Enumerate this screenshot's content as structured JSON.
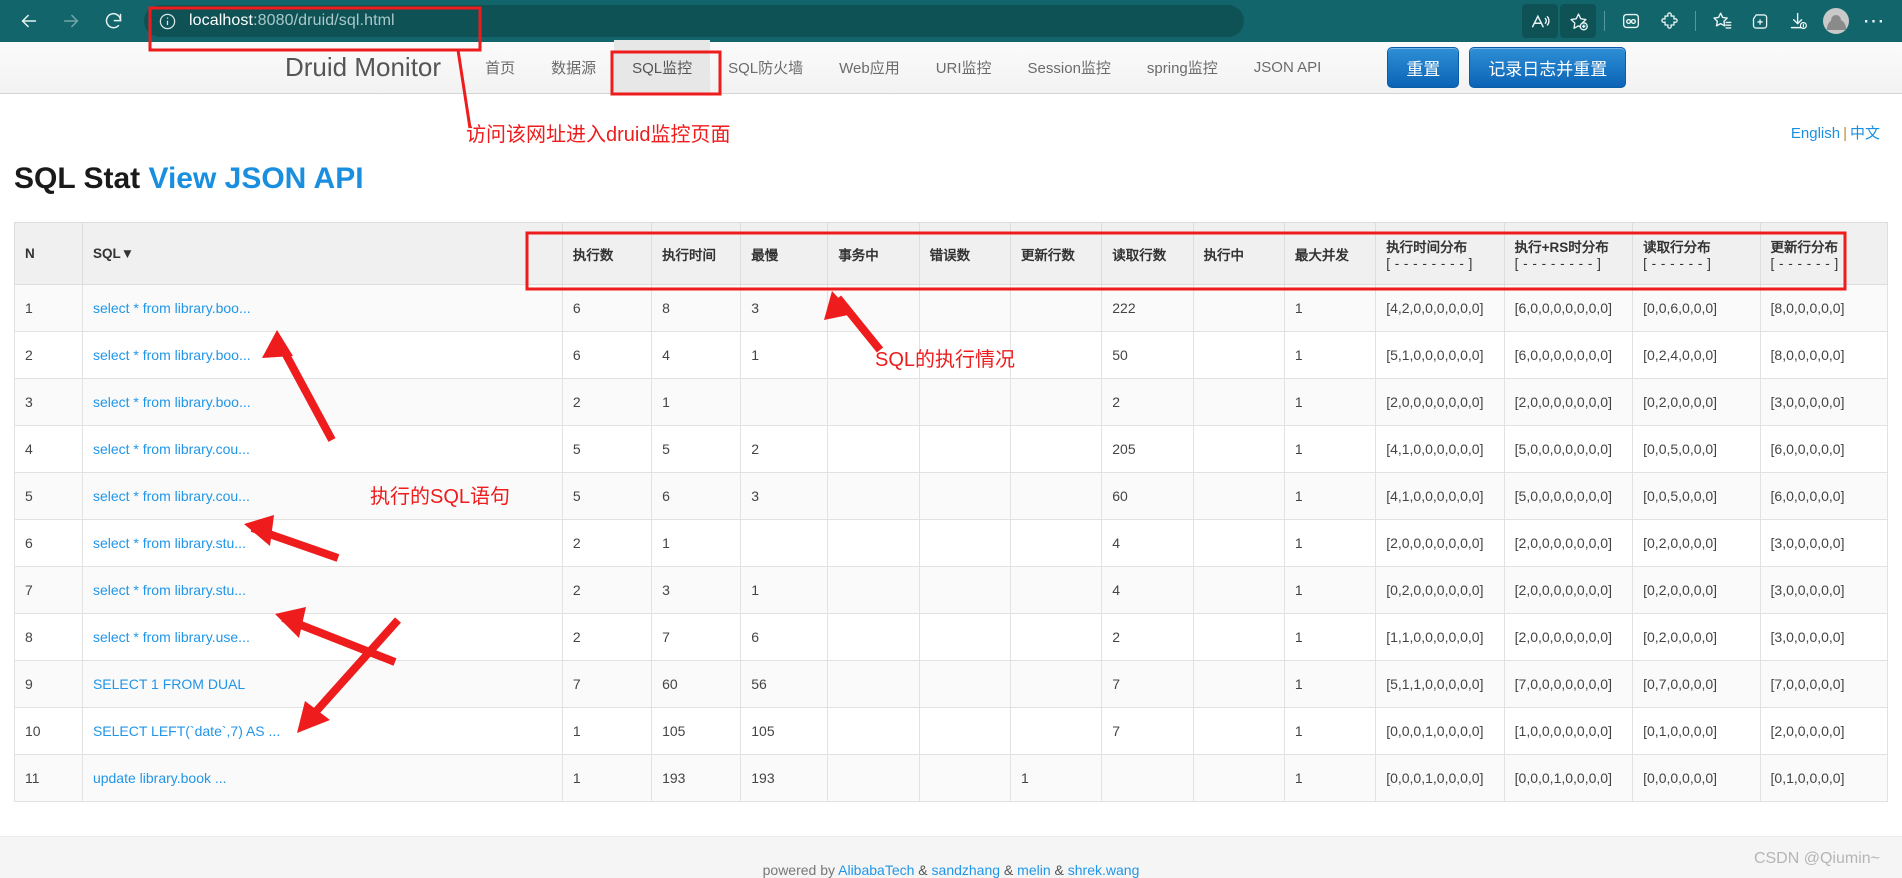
{
  "browser": {
    "url_prefix": "localhost",
    "url_suffix": ":8080/druid/sql.html",
    "back_icon": "back-arrow-icon",
    "forward_icon": "forward-arrow-icon",
    "reload_icon": "reload-icon",
    "info_icon": "info-circle-icon",
    "toolbar_icons": [
      "read-aloud-icon",
      "add-favorite-icon",
      "collections-icon",
      "extensions-icon",
      "favorites-icon",
      "tab-actions-icon",
      "downloads-icon",
      "profile-avatar-icon",
      "settings-more-icon"
    ]
  },
  "nav": {
    "brand": "Druid Monitor",
    "items": [
      {
        "label": "首页",
        "active": false
      },
      {
        "label": "数据源",
        "active": false
      },
      {
        "label": "SQL监控",
        "active": true
      },
      {
        "label": "SQL防火墙",
        "active": false
      },
      {
        "label": "Web应用",
        "active": false
      },
      {
        "label": "URI监控",
        "active": false
      },
      {
        "label": "Session监控",
        "active": false
      },
      {
        "label": "spring监控",
        "active": false
      },
      {
        "label": "JSON API",
        "active": false
      }
    ],
    "reset_button": "重置",
    "log_and_reset_button": "记录日志并重置"
  },
  "lang": {
    "english": "English",
    "separator": "|",
    "chinese": "中文"
  },
  "page": {
    "title": "SQL Stat",
    "api_link": "View JSON API"
  },
  "annotations": [
    {
      "name": "url-annotation",
      "text": "访问该网址进入druid监控页面",
      "color": "#ee1c1c"
    },
    {
      "name": "sql-stmt-annotation",
      "text": "执行的SQL语句",
      "color": "#ee1c1c"
    },
    {
      "name": "sql-exec-annotation",
      "text": "SQL的执行情况",
      "color": "#ee1c1c"
    }
  ],
  "table": {
    "headers": {
      "n": "N",
      "sql": "SQL▼",
      "exec_count": "执行数",
      "exec_time": "执行时间",
      "slowest": "最慢",
      "in_transaction": "事务中",
      "error_count": "错误数",
      "update_rows": "更新行数",
      "fetch_rows": "读取行数",
      "running": "执行中",
      "max_concurrent": "最大并发",
      "exec_time_dist": "执行时间分布",
      "exec_time_dist_bracket": "[ - - - - - - - - ]",
      "exec_rs_dist": "执行+RS时分布",
      "exec_rs_dist_bracket": "[ - - - - - - - - ]",
      "fetch_row_dist": "读取行分布",
      "fetch_row_dist_bracket": "[ - - - - - - ]",
      "update_row_dist": "更新行分布",
      "update_row_dist_bracket": "[ - - - - - - ]"
    },
    "rows": [
      {
        "n": "1",
        "sql": "select * from library.boo...",
        "exec_count": "6",
        "exec_time": "8",
        "slowest": "3",
        "in_transaction": "",
        "error_count": "",
        "update_rows": "",
        "fetch_rows": "222",
        "running": "",
        "max_concurrent": "1",
        "exec_time_dist": "[4,2,0,0,0,0,0,0]",
        "exec_rs_dist": "[6,0,0,0,0,0,0,0]",
        "fetch_row_dist": "[0,0,6,0,0,0]",
        "update_row_dist": "[8,0,0,0,0,0]"
      },
      {
        "n": "2",
        "sql": "select * from library.boo...",
        "exec_count": "6",
        "exec_time": "4",
        "slowest": "1",
        "in_transaction": "",
        "error_count": "",
        "update_rows": "",
        "fetch_rows": "50",
        "running": "",
        "max_concurrent": "1",
        "exec_time_dist": "[5,1,0,0,0,0,0,0]",
        "exec_rs_dist": "[6,0,0,0,0,0,0,0]",
        "fetch_row_dist": "[0,2,4,0,0,0]",
        "update_row_dist": "[8,0,0,0,0,0]"
      },
      {
        "n": "3",
        "sql": "select * from library.boo...",
        "exec_count": "2",
        "exec_time": "1",
        "slowest": "",
        "in_transaction": "",
        "error_count": "",
        "update_rows": "",
        "fetch_rows": "2",
        "running": "",
        "max_concurrent": "1",
        "exec_time_dist": "[2,0,0,0,0,0,0,0]",
        "exec_rs_dist": "[2,0,0,0,0,0,0,0]",
        "fetch_row_dist": "[0,2,0,0,0,0]",
        "update_row_dist": "[3,0,0,0,0,0]"
      },
      {
        "n": "4",
        "sql": "select * from library.cou...",
        "exec_count": "5",
        "exec_time": "5",
        "slowest": "2",
        "in_transaction": "",
        "error_count": "",
        "update_rows": "",
        "fetch_rows": "205",
        "running": "",
        "max_concurrent": "1",
        "exec_time_dist": "[4,1,0,0,0,0,0,0]",
        "exec_rs_dist": "[5,0,0,0,0,0,0,0]",
        "fetch_row_dist": "[0,0,5,0,0,0]",
        "update_row_dist": "[6,0,0,0,0,0]"
      },
      {
        "n": "5",
        "sql": "select * from library.cou...",
        "exec_count": "5",
        "exec_time": "6",
        "slowest": "3",
        "in_transaction": "",
        "error_count": "",
        "update_rows": "",
        "fetch_rows": "60",
        "running": "",
        "max_concurrent": "1",
        "exec_time_dist": "[4,1,0,0,0,0,0,0]",
        "exec_rs_dist": "[5,0,0,0,0,0,0,0]",
        "fetch_row_dist": "[0,0,5,0,0,0]",
        "update_row_dist": "[6,0,0,0,0,0]"
      },
      {
        "n": "6",
        "sql": "select * from library.stu...",
        "exec_count": "2",
        "exec_time": "1",
        "slowest": "",
        "in_transaction": "",
        "error_count": "",
        "update_rows": "",
        "fetch_rows": "4",
        "running": "",
        "max_concurrent": "1",
        "exec_time_dist": "[2,0,0,0,0,0,0,0]",
        "exec_rs_dist": "[2,0,0,0,0,0,0,0]",
        "fetch_row_dist": "[0,2,0,0,0,0]",
        "update_row_dist": "[3,0,0,0,0,0]"
      },
      {
        "n": "7",
        "sql": "select * from library.stu...",
        "exec_count": "2",
        "exec_time": "3",
        "slowest": "1",
        "in_transaction": "",
        "error_count": "",
        "update_rows": "",
        "fetch_rows": "4",
        "running": "",
        "max_concurrent": "1",
        "exec_time_dist": "[0,2,0,0,0,0,0,0]",
        "exec_rs_dist": "[2,0,0,0,0,0,0,0]",
        "fetch_row_dist": "[0,2,0,0,0,0]",
        "update_row_dist": "[3,0,0,0,0,0]"
      },
      {
        "n": "8",
        "sql": "select * from library.use...",
        "exec_count": "2",
        "exec_time": "7",
        "slowest": "6",
        "in_transaction": "",
        "error_count": "",
        "update_rows": "",
        "fetch_rows": "2",
        "running": "",
        "max_concurrent": "1",
        "exec_time_dist": "[1,1,0,0,0,0,0,0]",
        "exec_rs_dist": "[2,0,0,0,0,0,0,0]",
        "fetch_row_dist": "[0,2,0,0,0,0]",
        "update_row_dist": "[3,0,0,0,0,0]"
      },
      {
        "n": "9",
        "sql": "SELECT 1 FROM DUAL",
        "exec_count": "7",
        "exec_time": "60",
        "slowest": "56",
        "in_transaction": "",
        "error_count": "",
        "update_rows": "",
        "fetch_rows": "7",
        "running": "",
        "max_concurrent": "1",
        "exec_time_dist": "[5,1,1,0,0,0,0,0]",
        "exec_rs_dist": "[7,0,0,0,0,0,0,0]",
        "fetch_row_dist": "[0,7,0,0,0,0]",
        "update_row_dist": "[7,0,0,0,0,0]"
      },
      {
        "n": "10",
        "sql": "SELECT LEFT(`date`,7) AS ...",
        "exec_count": "1",
        "exec_time": "105",
        "slowest": "105",
        "in_transaction": "",
        "error_count": "",
        "update_rows": "",
        "fetch_rows": "7",
        "running": "",
        "max_concurrent": "1",
        "exec_time_dist": "[0,0,0,1,0,0,0,0]",
        "exec_rs_dist": "[1,0,0,0,0,0,0,0]",
        "fetch_row_dist": "[0,1,0,0,0,0]",
        "update_row_dist": "[2,0,0,0,0,0]"
      },
      {
        "n": "11",
        "sql": "update library.book ...",
        "exec_count": "1",
        "exec_time": "193",
        "slowest": "193",
        "in_transaction": "",
        "error_count": "",
        "update_rows": "1",
        "fetch_rows": "",
        "running": "",
        "max_concurrent": "1",
        "exec_time_dist": "[0,0,0,1,0,0,0,0]",
        "exec_rs_dist": "[0,0,0,1,0,0,0,0]",
        "fetch_row_dist": "[0,0,0,0,0,0]",
        "update_row_dist": "[0,1,0,0,0,0]"
      }
    ]
  },
  "footer": {
    "prefix": "powered by ",
    "link1": "AlibabaTech",
    "amp1": " & ",
    "link2": "sandzhang",
    "amp2": " & ",
    "link3": "melin",
    "amp3": " & ",
    "link4": "shrek.wang"
  },
  "watermark": "CSDN @Qiumin~"
}
